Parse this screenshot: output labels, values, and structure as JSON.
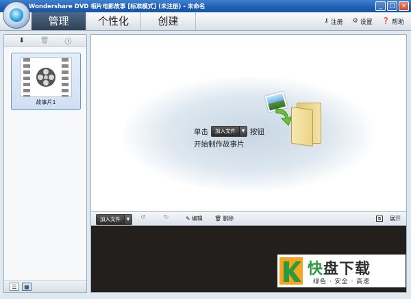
{
  "window": {
    "title": "Wondershare DVD 相片电影故事 [标准模式] (未注册) - 未命名",
    "controls": [
      "_",
      "□",
      "×"
    ]
  },
  "tabs": [
    {
      "label": "管理",
      "active": true
    },
    {
      "label": "个性化",
      "active": false
    },
    {
      "label": "创建",
      "active": false
    }
  ],
  "toplinks": {
    "register": "注册",
    "settings": "设置",
    "help": "帮助"
  },
  "left_panel": {
    "clip_label": "故事片1"
  },
  "main": {
    "hint_prefix": "单击",
    "hint_suffix": "按钮",
    "hint_line2": "开始制作故事片",
    "add_file_button": "加入文件"
  },
  "timeline_toolbar": {
    "add_file": "加入文件",
    "edit": "编辑",
    "delete": "删除",
    "expand": "展开"
  },
  "watermark": {
    "title_1": "快",
    "title_2": "盘下载",
    "subtitle": "绿色 · 安全 · 高速"
  },
  "colors": {
    "active_tab": "#3c5470",
    "titlebar": "#1f5fb2",
    "storyboard": "#221f1d",
    "watermark_green": "#2b9a3d"
  }
}
